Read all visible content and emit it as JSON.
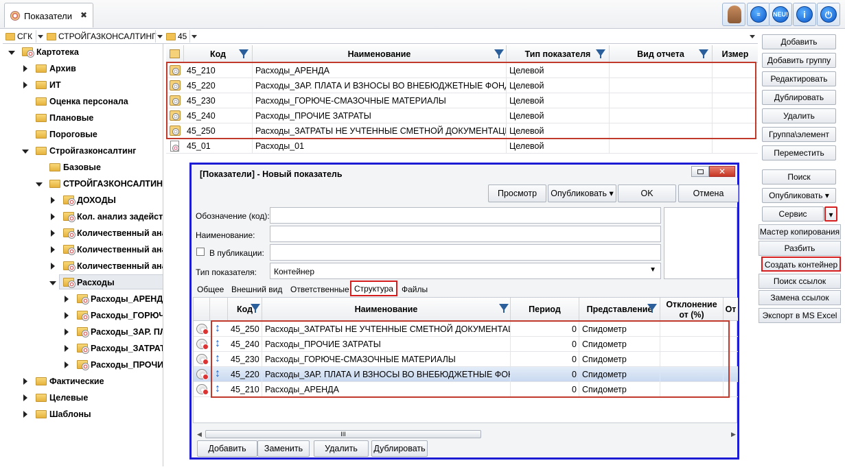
{
  "tab": {
    "label": "Показатели",
    "close": "✖"
  },
  "toolbar_icons": {
    "neu": "NEU!",
    "help": "i"
  },
  "crumbs": [
    "СГК",
    "СТРОЙГАЗКОНСАЛТИНГ",
    "45"
  ],
  "tree": {
    "root": "Картотека",
    "items": [
      "Архив",
      "ИТ",
      "Оценка персонала",
      "Плановые",
      "Пороговые",
      "Стройгазконсалтинг",
      "Базовые",
      "СТРОЙГАЗКОНСАЛТИНГ",
      "ДОХОДЫ",
      "Кол. анализ задейств",
      "Количественный анал",
      "Количественный анал",
      "Количественный анал",
      "Расходы",
      "Расходы_АРЕНДА",
      "Расходы_ГОРЮЧЕ",
      "Расходы_ЗАР. ПЛ.",
      "Расходы_ЗАТРАТЬ",
      "Расходы_ПРОЧИЕ",
      "Фактические",
      "Целевые",
      "Шаблоны"
    ]
  },
  "grid": {
    "headers": [
      "Код",
      "Наименование",
      "Тип показателя",
      "Вид отчета",
      "Измер"
    ],
    "rows": [
      {
        "code": "45_210",
        "name": "Расходы_АРЕНДА",
        "type": "Целевой"
      },
      {
        "code": "45_220",
        "name": "Расходы_ЗАР. ПЛАТА И ВЗНОСЫ ВО ВНЕБЮДЖЕТНЫЕ ФОНДЫ",
        "type": "Целевой"
      },
      {
        "code": "45_230",
        "name": "Расходы_ГОРЮЧЕ-СМАЗОЧНЫЕ МАТЕРИАЛЫ",
        "type": "Целевой"
      },
      {
        "code": "45_240",
        "name": "Расходы_ПРОЧИЕ ЗАТРАТЫ",
        "type": "Целевой"
      },
      {
        "code": "45_250",
        "name": "Расходы_ЗАТРАТЫ НЕ УЧТЕННЫЕ СМЕТНОЙ ДОКУМЕНТАЦИЕЙ",
        "type": "Целевой"
      },
      {
        "code": "45_01",
        "name": "Расходы_01",
        "type": "Целевой"
      }
    ]
  },
  "actions": [
    "Добавить",
    "Добавить группу",
    "Редактировать",
    "Дублировать",
    "Удалить",
    "Группа\\элемент",
    "Переместить",
    "Поиск",
    "Опубликовать",
    "Сервис"
  ],
  "service_menu": [
    "Мастер копирования",
    "Разбить",
    "Создать контейнер",
    "Поиск ссылок",
    "Замена ссылок",
    "Экспорт в MS Excel"
  ],
  "dialog": {
    "title": "[Показатели] - Новый показатель",
    "buttons": {
      "preview": "Просмотр",
      "publish": "Опубликовать",
      "ok": "OK",
      "cancel": "Отмена"
    },
    "fields": {
      "code": "Обозначение (код):",
      "name": "Наименование:",
      "publish": "В публикации:",
      "type": "Тип показателя:",
      "type_value": "Контейнер"
    },
    "tabs": [
      "Общее",
      "Внешний вид",
      "Ответственные",
      "Структура",
      "Файлы"
    ],
    "grid_headers": [
      "Код",
      "Наименование",
      "Период",
      "Представление",
      "Отклонение от (%)",
      "От"
    ],
    "grid_rows": [
      {
        "code": "45_250",
        "name": "Расходы_ЗАТРАТЫ НЕ УЧТЕННЫЕ СМЕТНОЙ ДОКУМЕНТАЦИЕЙ",
        "period": "0",
        "view": "Спидометр"
      },
      {
        "code": "45_240",
        "name": "Расходы_ПРОЧИЕ ЗАТРАТЫ",
        "period": "0",
        "view": "Спидометр"
      },
      {
        "code": "45_230",
        "name": "Расходы_ГОРЮЧЕ-СМАЗОЧНЫЕ МАТЕРИАЛЫ",
        "period": "0",
        "view": "Спидометр"
      },
      {
        "code": "45_220",
        "name": "Расходы_ЗАР. ПЛАТА И ВЗНОСЫ ВО ВНЕБЮДЖЕТНЫЕ ФОНДЫ",
        "period": "0",
        "view": "Спидометр"
      },
      {
        "code": "45_210",
        "name": "Расходы_АРЕНДА",
        "period": "0",
        "view": "Спидометр"
      }
    ],
    "bottom_buttons": [
      "Добавить",
      "Заменить",
      "Удалить",
      "Дублировать"
    ],
    "scroll_grip": "III"
  }
}
